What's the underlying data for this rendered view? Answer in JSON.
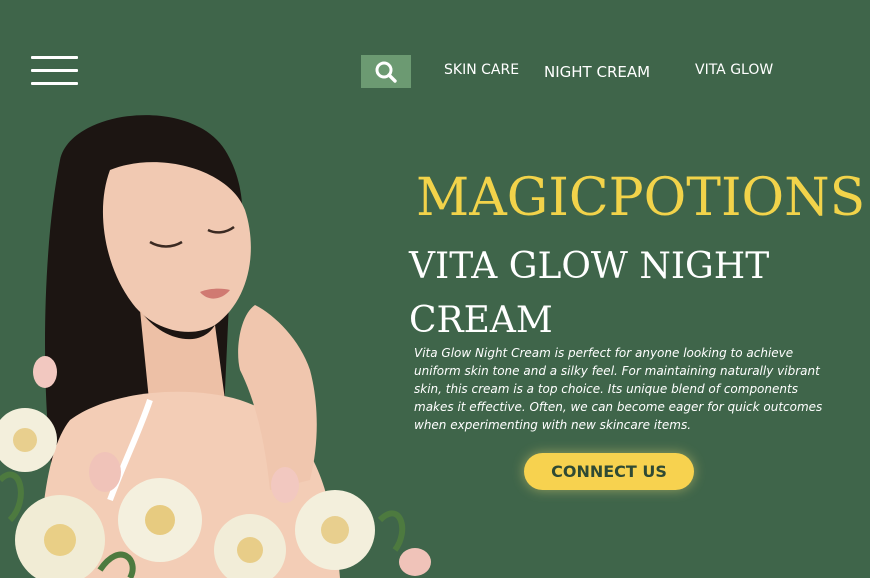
{
  "header": {
    "menu_icon": "hamburger-menu-icon",
    "search_icon": "search-icon",
    "nav": [
      {
        "label": "SKIN CARE"
      },
      {
        "label": "NIGHT CREAM"
      },
      {
        "label": "VITA GLOW"
      }
    ]
  },
  "main": {
    "brand": "MAGICPOTIONS",
    "headline_line1": "VITA GLOW NIGHT",
    "headline_line2": "CREAM",
    "description": "Vita Glow Night Cream is perfect for anyone looking to achieve uniform skin tone and a silky feel. For maintaining naturally vibrant skin, this cream is a top choice. Its unique blend of components makes it effective. Often, we can become eager for quick outcomes when experimenting with new skincare items.",
    "cta_label": "CONNECT US"
  },
  "colors": {
    "background": "#3f654a",
    "accent": "#f2d34a",
    "button": "#f7d24f",
    "search_bg": "#6c9a72"
  }
}
